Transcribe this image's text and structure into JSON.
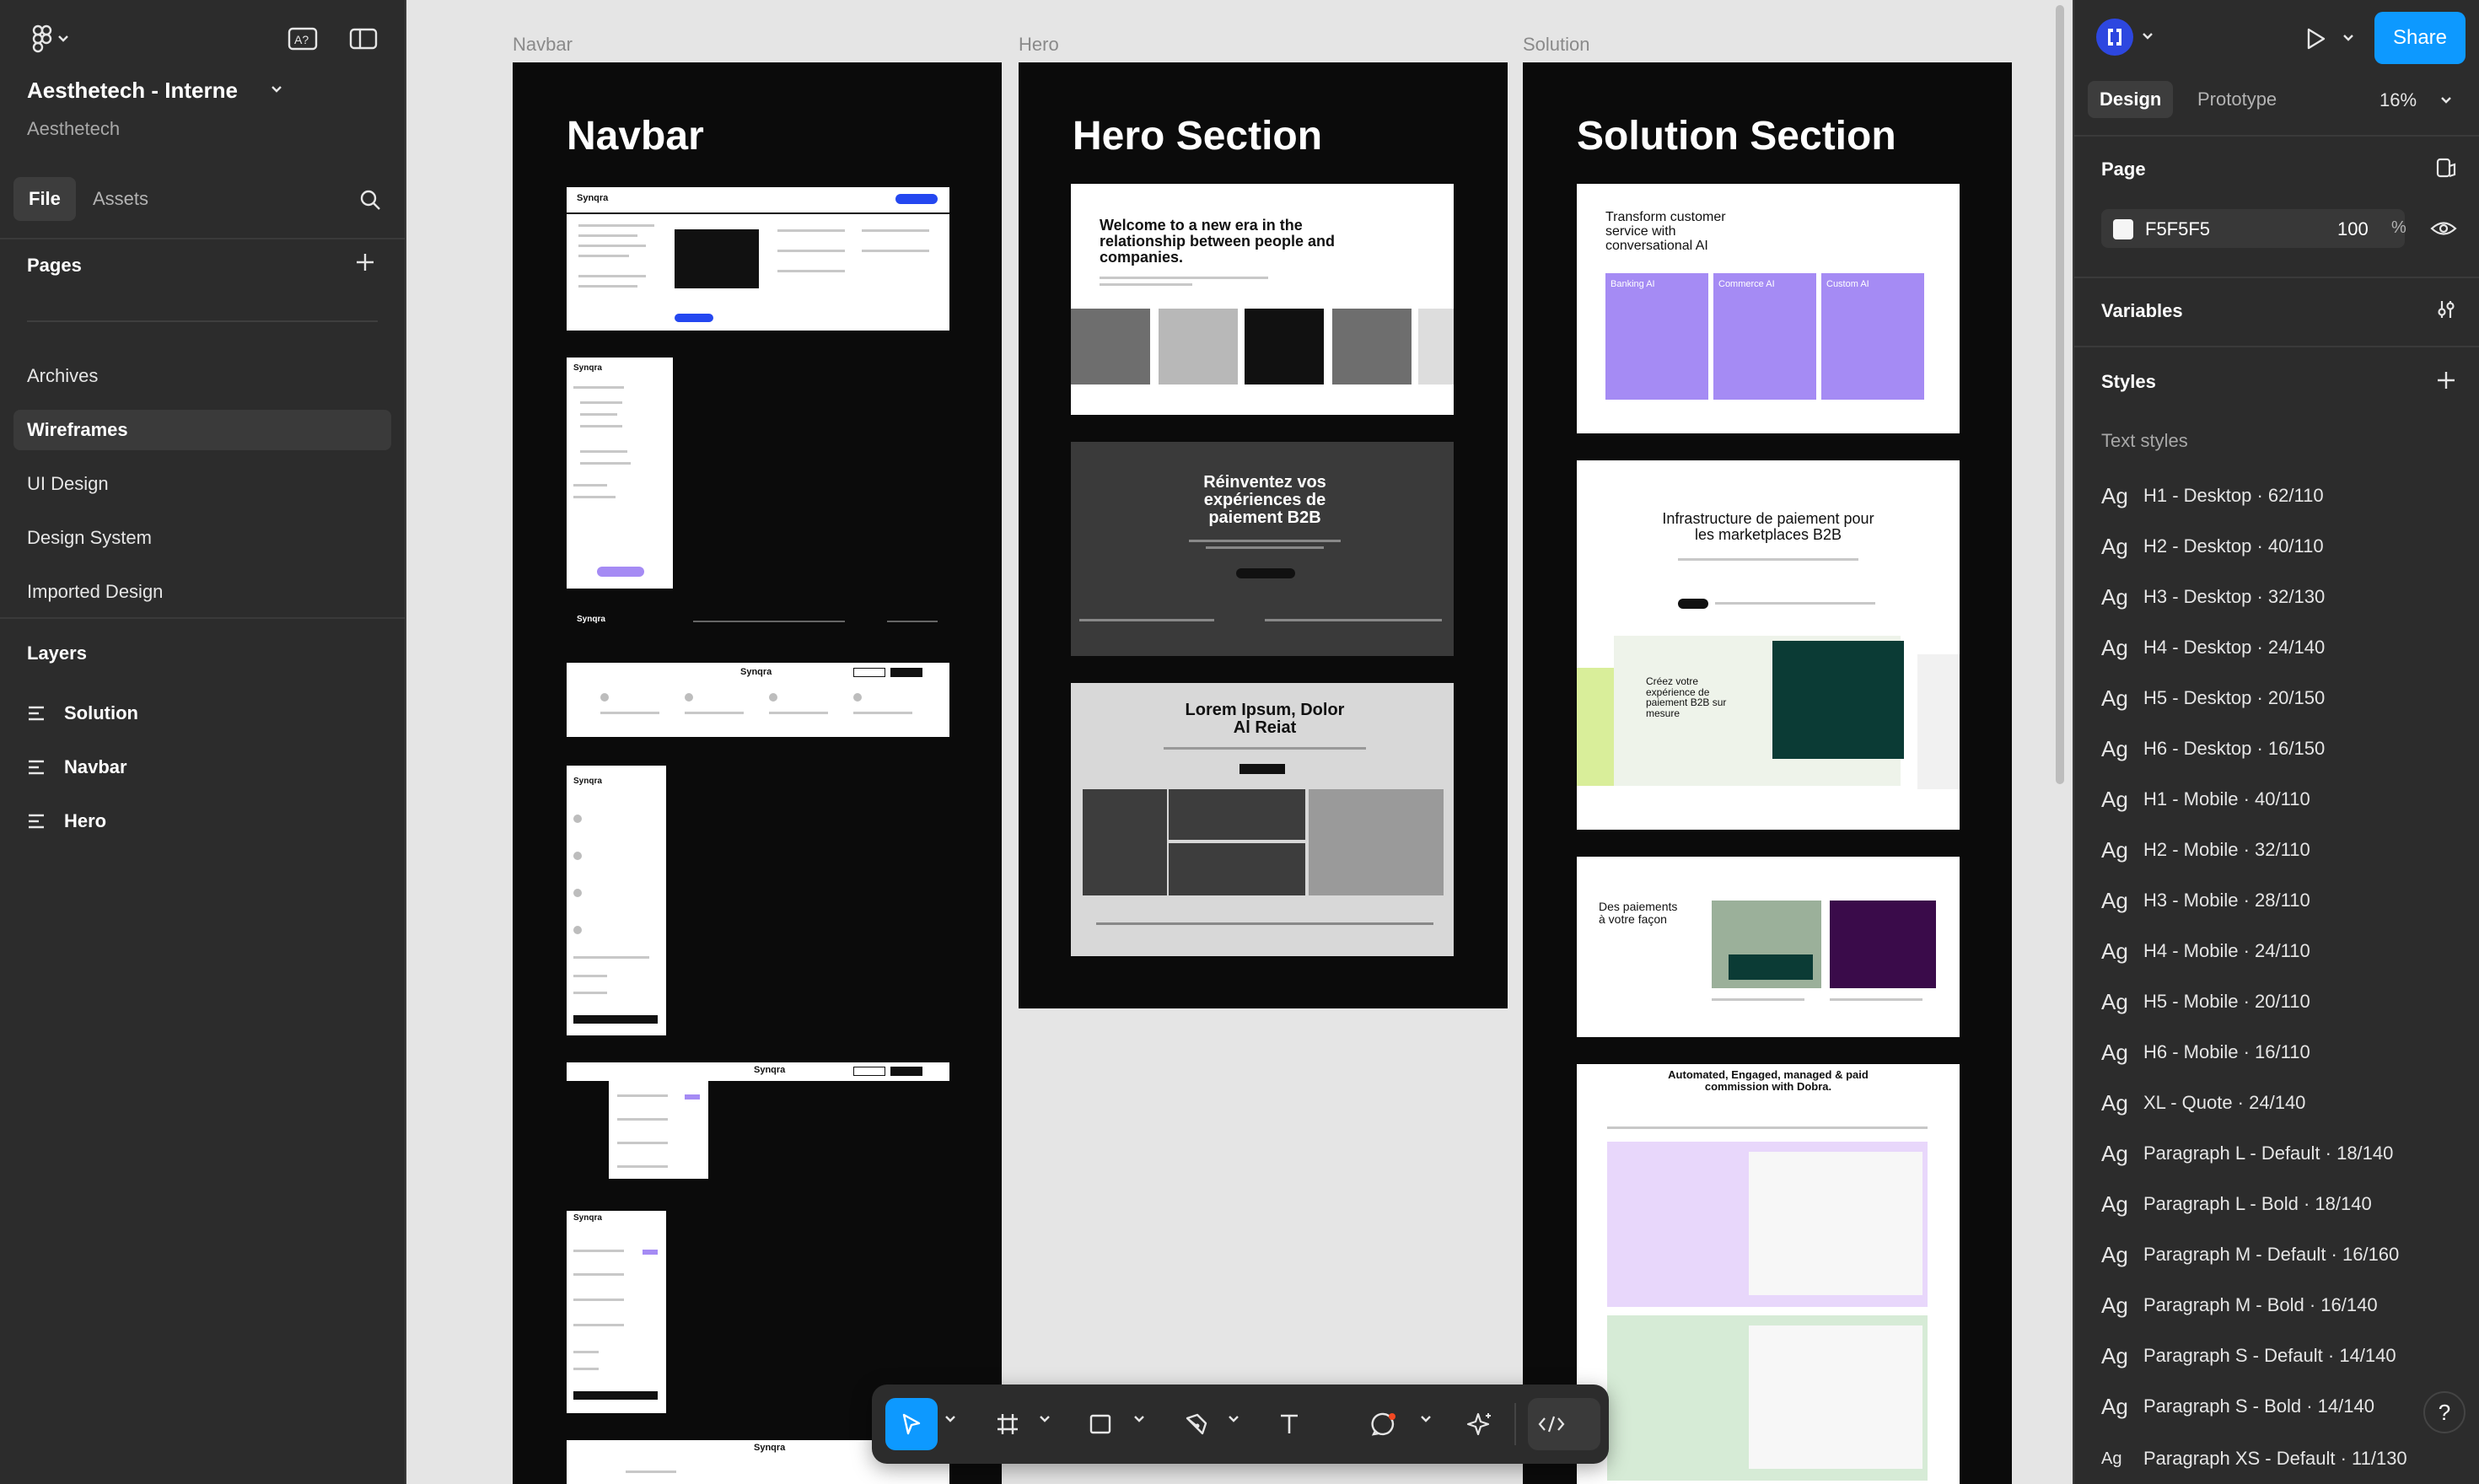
{
  "file": {
    "title": "Aesthetech - Interne",
    "team": "Aesthetech"
  },
  "left_tabs": {
    "file": "File",
    "assets": "Assets"
  },
  "pages": {
    "title": "Pages",
    "items": [
      "Archives",
      "Wireframes",
      "UI Design",
      "Design System",
      "Imported Design"
    ],
    "selected": "Wireframes"
  },
  "layers": {
    "title": "Layers",
    "items": [
      "Solution",
      "Navbar",
      "Hero"
    ]
  },
  "canvas": {
    "frames": [
      {
        "label": "Navbar",
        "heading": "Navbar"
      },
      {
        "label": "Hero",
        "heading": "Hero Section"
      },
      {
        "label": "Solution",
        "heading": "Solution Section"
      }
    ],
    "hero_thumbs": {
      "t1": "Welcome to a new era in the relationship between people and companies.",
      "t2": "Réinventez vos expériences de paiement B2B",
      "t3": "Lorem Ipsum, Dolor Al Reiat"
    },
    "solution_thumbs": {
      "t1": "Transform customer service with conversational AI",
      "t1_cards": [
        "Banking AI",
        "Commerce AI",
        "Custom AI"
      ],
      "t2": "Infrastructure de paiement pour les marketplaces B2B",
      "t2b": "Créez votre expérience de paiement B2B sur mesure",
      "t3": "Des paiements à votre façon",
      "t4": "Automated, Engaged, managed & paid commission with Dobra."
    },
    "navbar_brand": "Synqra"
  },
  "toolbar": {
    "tools": [
      "move-tool",
      "frame-tool",
      "rectangle-tool",
      "pen-tool",
      "text-tool",
      "comment-tool",
      "actions-tool",
      "dev-mode-toggle"
    ],
    "active": "move-tool"
  },
  "right": {
    "share": "Share",
    "tabs": {
      "design": "Design",
      "prototype": "Prototype"
    },
    "zoom": "16%",
    "page": {
      "title": "Page",
      "color": "F5F5F5",
      "opacity": "100",
      "unit": "%"
    },
    "variables": "Variables",
    "styles": "Styles",
    "text_styles_label": "Text styles",
    "text_styles": [
      "H1 - Desktop · 62/110",
      "H2 - Desktop · 40/110",
      "H3 - Desktop · 32/130",
      "H4 - Desktop · 24/140",
      "H5 - Desktop · 20/150",
      "H6 - Desktop · 16/150",
      "H1 - Mobile · 40/110",
      "H2 - Mobile · 32/110",
      "H3 - Mobile · 28/110",
      "H4 - Mobile · 24/110",
      "H5 - Mobile · 20/110",
      "H6 - Mobile · 16/110",
      "XL - Quote · 24/140",
      "Paragraph L - Default · 18/140",
      "Paragraph L - Bold · 18/140",
      "Paragraph M - Default · 16/160",
      "Paragraph M - Bold · 16/140",
      "Paragraph S - Default · 14/140",
      "Paragraph S - Bold · 14/140",
      "Paragraph XS - Default · 11/130"
    ],
    "ag_glyph": "Ag",
    "help": "?"
  },
  "colors": {
    "accent": "#0d99ff",
    "panel": "#2c2c2c",
    "canvas": "#e5e5e5",
    "frame": "#0b0b0b",
    "purple": "#a58bf4"
  }
}
